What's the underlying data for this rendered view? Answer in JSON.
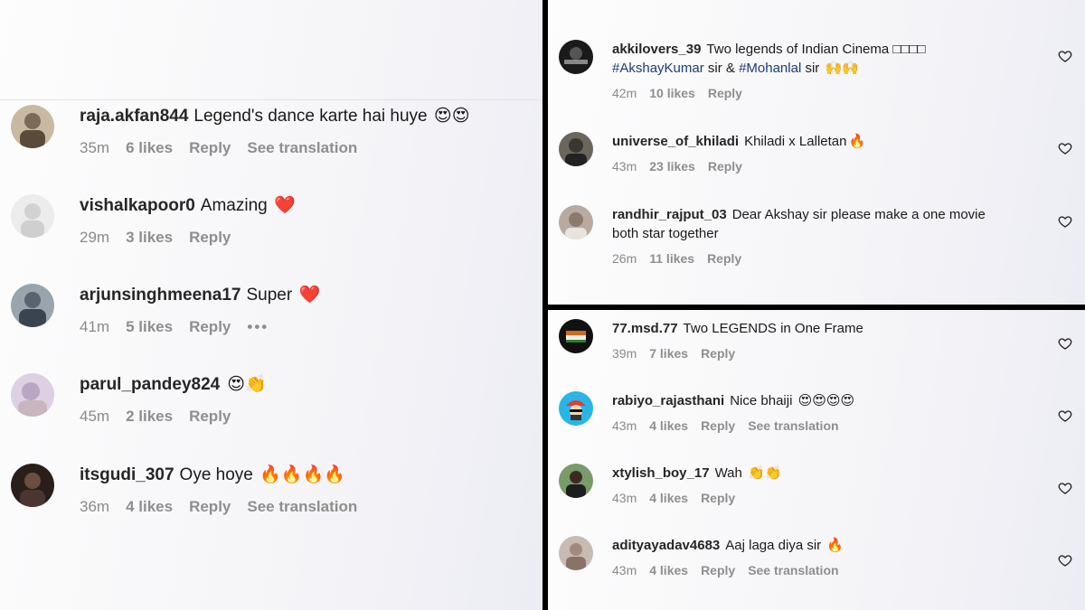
{
  "left_panel": {
    "comments": [
      {
        "username": "raja.akfan844",
        "text": "Legend's dance karte hai huye",
        "emoji": "😍😍",
        "time": "35m",
        "likes": "6 likes",
        "reply": "Reply",
        "translation": "See translation",
        "avatar_color": "#7a6a5a"
      },
      {
        "username": "vishalkapoor0",
        "text": "Amazing",
        "emoji": "❤️",
        "time": "29m",
        "likes": "3 likes",
        "reply": "Reply",
        "translation": "",
        "avatar_color": "#d9d9d9"
      },
      {
        "username": "arjunsinghmeena17",
        "text": "Super",
        "emoji": "❤️",
        "time": "41m",
        "likes": "5 likes",
        "reply": "Reply",
        "more": "•••",
        "avatar_color": "#5a6470"
      },
      {
        "username": "parul_pandey824",
        "text": "",
        "emoji": "😍👏",
        "time": "45m",
        "likes": "2 likes",
        "reply": "Reply",
        "translation": "",
        "avatar_color": "#b9a6c4"
      },
      {
        "username": "itsgudi_307",
        "text": "Oye hoye",
        "emoji": "🔥🔥🔥🔥",
        "time": "36m",
        "likes": "4 likes",
        "reply": "Reply",
        "translation": "See translation",
        "avatar_color": "#4a3530"
      }
    ]
  },
  "top_right_panel": {
    "comments": [
      {
        "username": "akkilovers_39",
        "text": "Two legends of Indian Cinema □□□□",
        "line2_hashtag1": "#AkshayKumar",
        "line2_mid": " sir & ",
        "line2_hashtag2": "#Mohanlal",
        "line2_end": " sir",
        "emoji": "🙌🙌",
        "time": "42m",
        "likes": "10 likes",
        "reply": "Reply",
        "avatar_color": "#2a2a2a"
      },
      {
        "username": "universe_of_khiladi",
        "text": "Khiladi x Lalletan",
        "emoji": "🔥",
        "time": "43m",
        "likes": "23 likes",
        "reply": "Reply",
        "avatar_color": "#3a3630"
      },
      {
        "username": "randhir_rajput_03",
        "text": "Dear Akshay sir please make a one movie",
        "line2": "both star together",
        "time": "26m",
        "likes": "11 likes",
        "reply": "Reply",
        "avatar_color": "#8a7a6e"
      }
    ]
  },
  "bottom_right_panel": {
    "comments": [
      {
        "username": "77.msd.77",
        "text": "Two LEGENDS in One Frame",
        "emoji": "",
        "time": "39m",
        "likes": "7 likes",
        "reply": "Reply",
        "translation": "",
        "avatar_color": "#1a1a1a"
      },
      {
        "username": "rabiyo_rajasthani",
        "text": "Nice bhaiji",
        "emoji": "😍😍😍😍",
        "time": "43m",
        "likes": "4 likes",
        "reply": "Reply",
        "translation": "See translation",
        "avatar_color": "#29b6e6"
      },
      {
        "username": "xtylish_boy_17",
        "text": "Wah",
        "emoji": "👏👏",
        "time": "43m",
        "likes": "4 likes",
        "reply": "Reply",
        "translation": "",
        "avatar_color": "#3a5a3a"
      },
      {
        "username": "adityayadav4683",
        "text": "Aaj laga diya sir",
        "emoji": "🔥",
        "time": "43m",
        "likes": "4 likes",
        "reply": "Reply",
        "translation": "See translation",
        "avatar_color": "#a08a80"
      }
    ]
  },
  "colors": {
    "background": "#f7f7f9",
    "divider": "#000000",
    "meta_text": "#8a8a8a",
    "hashtag": "#1f3a7a"
  }
}
